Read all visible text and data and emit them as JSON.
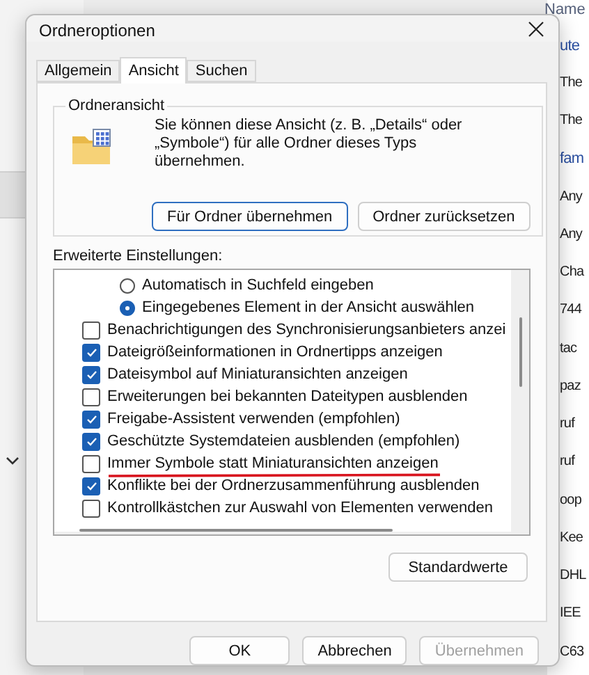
{
  "background": {
    "column_header": "Name",
    "items": [
      {
        "text": "ute",
        "kind": "heading"
      },
      {
        "text": "The",
        "kind": "file"
      },
      {
        "text": "The",
        "kind": "file"
      },
      {
        "text": "fam",
        "kind": "heading"
      },
      {
        "text": "Any",
        "kind": "file"
      },
      {
        "text": "Any",
        "kind": "file"
      },
      {
        "text": "Cha",
        "kind": "file"
      },
      {
        "text": "744",
        "kind": "file"
      },
      {
        "text": "tac",
        "kind": "file"
      },
      {
        "text": "paz",
        "kind": "file"
      },
      {
        "text": "ruf",
        "kind": "file"
      },
      {
        "text": "ruf",
        "kind": "file"
      },
      {
        "text": "oop",
        "kind": "file"
      },
      {
        "text": "Kee",
        "kind": "file"
      },
      {
        "text": "DHL",
        "kind": "file"
      },
      {
        "text": "IEE",
        "kind": "file"
      },
      {
        "text": "C63",
        "kind": "file"
      }
    ]
  },
  "dialog": {
    "title": "Ordneroptionen",
    "tabs": [
      {
        "label": "Allgemein",
        "selected": false
      },
      {
        "label": "Ansicht",
        "selected": true
      },
      {
        "label": "Suchen",
        "selected": false
      }
    ],
    "folder_view": {
      "title": "Ordneransicht",
      "description": "Sie können diese Ansicht (z. B. „Details“ oder „Symbole“) für alle Ordner dieses Typs übernehmen.",
      "buttons": [
        {
          "label": "Für Ordner übernehmen",
          "focused": true
        },
        {
          "label": "Ordner zurücksetzen",
          "focused": false
        }
      ]
    },
    "advanced": {
      "label": "Erweiterte Einstellungen:",
      "items": [
        {
          "kind": "radio",
          "label": "Automatisch in Suchfeld eingeben",
          "selected": false
        },
        {
          "kind": "radio",
          "label": "Eingegebenes Element in der Ansicht auswählen",
          "selected": true
        },
        {
          "kind": "checkbox",
          "label": "Benachrichtigungen des Synchronisierungsanbieters anzei",
          "checked": false
        },
        {
          "kind": "checkbox",
          "label": "Dateigrößeinformationen in Ordnertipps anzeigen",
          "checked": true
        },
        {
          "kind": "checkbox",
          "label": "Dateisymbol auf Miniaturansichten anzeigen",
          "checked": true
        },
        {
          "kind": "checkbox",
          "label": "Erweiterungen bei bekannten Dateitypen ausblenden",
          "checked": false
        },
        {
          "kind": "checkbox",
          "label": "Freigabe-Assistent verwenden (empfohlen)",
          "checked": true
        },
        {
          "kind": "checkbox",
          "label": "Geschützte Systemdateien ausblenden (empfohlen)",
          "checked": true
        },
        {
          "kind": "checkbox",
          "label": "Immer Symbole statt Miniaturansichten anzeigen",
          "checked": false
        },
        {
          "kind": "checkbox",
          "label": "Konflikte bei der Ordnerzusammenführung ausblenden",
          "checked": true
        },
        {
          "kind": "checkbox",
          "label": "Kontrollkästchen zur Auswahl von Elementen verwenden",
          "checked": false
        }
      ],
      "restore_button": "Standardwerte"
    },
    "buttons": [
      {
        "label": "OK",
        "disabled": false
      },
      {
        "label": "Abbrechen",
        "disabled": false
      },
      {
        "label": "Übernehmen",
        "disabled": true
      }
    ]
  }
}
